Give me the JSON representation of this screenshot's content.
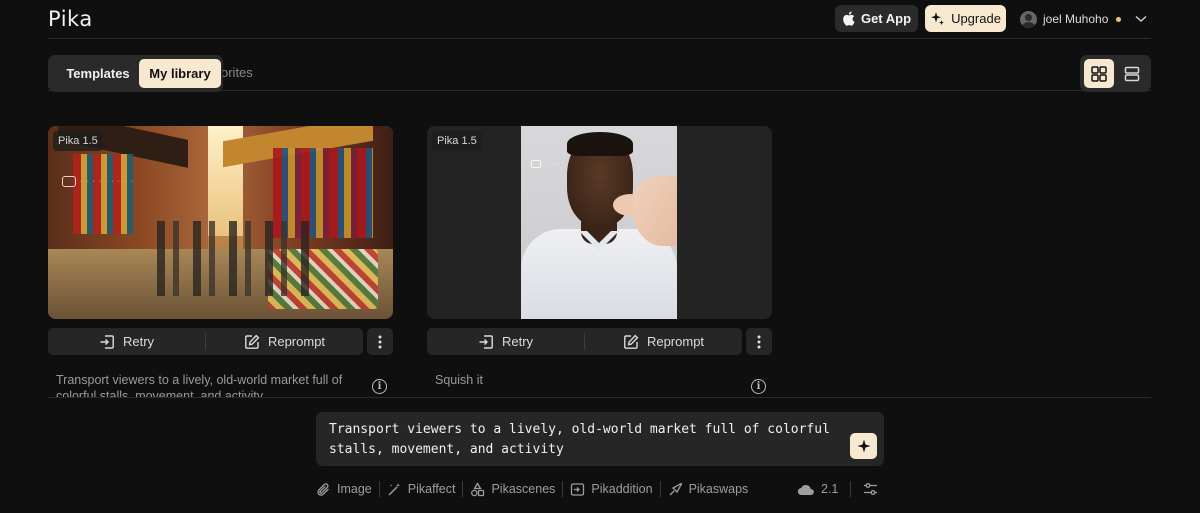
{
  "header": {
    "logo": "Pika",
    "get_app": "Get App",
    "upgrade": "Upgrade",
    "user_name": "joel Muhoho"
  },
  "tabs": {
    "templates": "Templates",
    "my_library": "My library",
    "hidden_tab": "orites"
  },
  "cards": [
    {
      "version": "Pika 1.5",
      "retry": "Retry",
      "reprompt": "Reprompt",
      "prompt": "Transport viewers to a lively, old-world market full of colorful stalls, movement, and activity"
    },
    {
      "version": "Pika 1.5",
      "retry": "Retry",
      "reprompt": "Reprompt",
      "prompt": "Squish it"
    }
  ],
  "prompt_box": {
    "value": "Transport viewers to a lively, old-world market full of colorful stalls, movement, and activity"
  },
  "toolbar": {
    "image": "Image",
    "pikaffect": "Pikaffect",
    "pikascenes": "Pikascenes",
    "pikaddition": "Pikaddition",
    "pikaswaps": "Pikaswaps",
    "model_version": "2.1"
  },
  "colors": {
    "background": "#0f0f0f",
    "accent": "#f6e9d0",
    "panel": "#262626",
    "status_dot": "#f3c46b"
  }
}
